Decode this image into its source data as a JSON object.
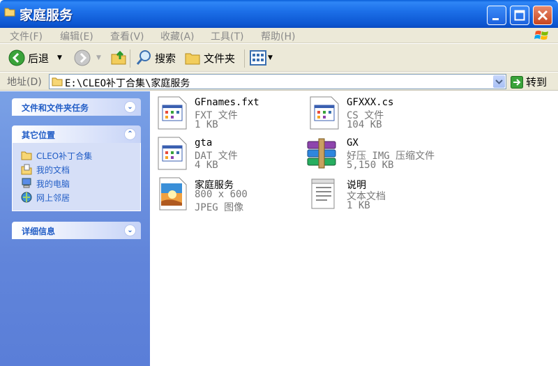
{
  "window": {
    "title": "家庭服务"
  },
  "menubar": {
    "items": [
      "文件(F)",
      "编辑(E)",
      "查看(V)",
      "收藏(A)",
      "工具(T)",
      "帮助(H)"
    ]
  },
  "toolbar": {
    "back_label": "后退",
    "search_label": "搜索",
    "folders_label": "文件夹"
  },
  "addressbar": {
    "label": "地址(D)",
    "value": "E:\\CLEO补丁合集\\家庭服务",
    "go_label": "转到"
  },
  "taskpane": {
    "file_tasks_title": "文件和文件夹任务",
    "other_places_title": "其它位置",
    "other_places": [
      {
        "label": "CLEO补丁合集",
        "icon": "folder-icon"
      },
      {
        "label": "我的文档",
        "icon": "my-documents-icon"
      },
      {
        "label": "我的电脑",
        "icon": "my-computer-icon"
      },
      {
        "label": "网上邻居",
        "icon": "network-places-icon"
      }
    ],
    "details_title": "详细信息"
  },
  "files": [
    {
      "name": "GFnames.fxt",
      "type": "FXT 文件",
      "size": "1 KB",
      "icon": "generic-file-icon"
    },
    {
      "name": "GFXXX.cs",
      "type": "CS 文件",
      "size": "104 KB",
      "icon": "generic-file-icon"
    },
    {
      "name": "gta",
      "type": "DAT 文件",
      "size": "4 KB",
      "icon": "generic-file-icon"
    },
    {
      "name": "GX",
      "type": "好压 IMG 压缩文件",
      "size": "5,150 KB",
      "icon": "archive-icon"
    },
    {
      "name": "家庭服务",
      "type": "800 x 600",
      "size": "JPEG 图像",
      "icon": "image-file-icon"
    },
    {
      "name": "说明",
      "type": "文本文档",
      "size": "1 KB",
      "icon": "text-document-icon"
    }
  ],
  "colors": {
    "titlebar": "#0d57d2",
    "taskpane": "#6185da",
    "link": "#215dc6"
  }
}
